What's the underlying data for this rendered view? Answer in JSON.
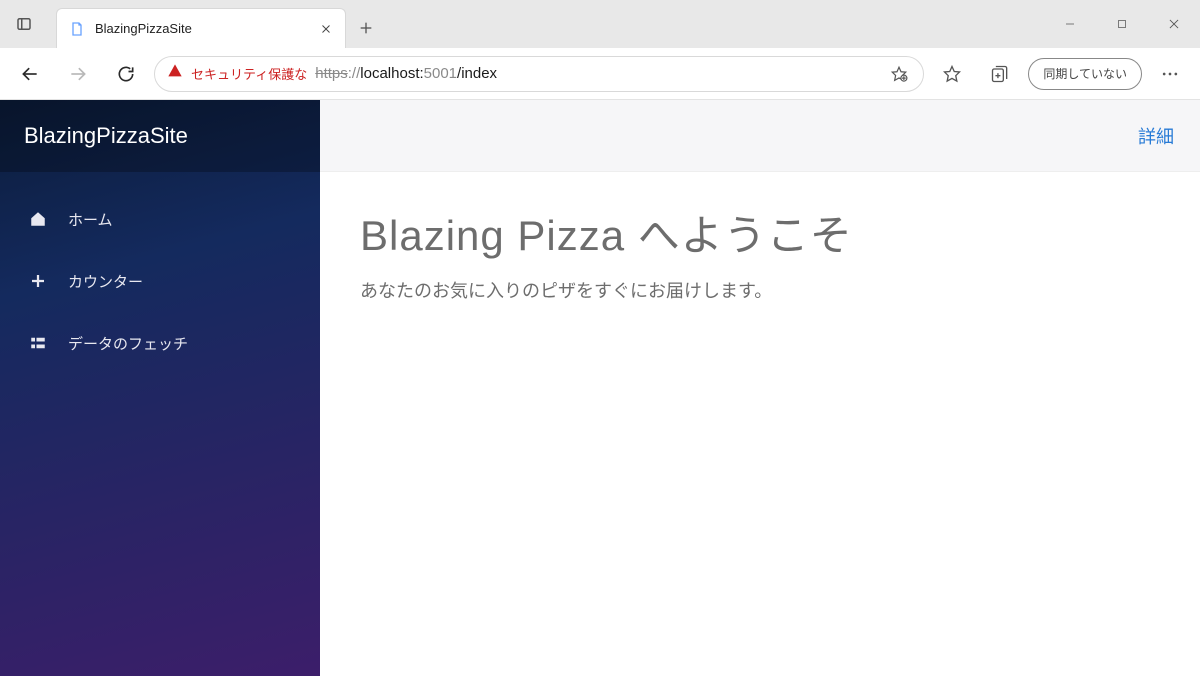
{
  "browser": {
    "tab_title": "BlazingPizzaSite",
    "security_text": "セキュリティ保護な",
    "url_scheme": "https",
    "url_colon": "://",
    "url_host": "localhost:",
    "url_port": "5001",
    "url_path": "/index",
    "profile_label": "同期していない"
  },
  "sidebar": {
    "brand": "BlazingPizzaSite",
    "items": [
      {
        "label": "ホーム"
      },
      {
        "label": "カウンター"
      },
      {
        "label": "データのフェッチ"
      }
    ]
  },
  "content": {
    "details_link": "詳細",
    "heading": "Blazing  Pizza へようこそ",
    "subheading": "あなたのお気に入りのピザをすぐにお届けします。"
  }
}
